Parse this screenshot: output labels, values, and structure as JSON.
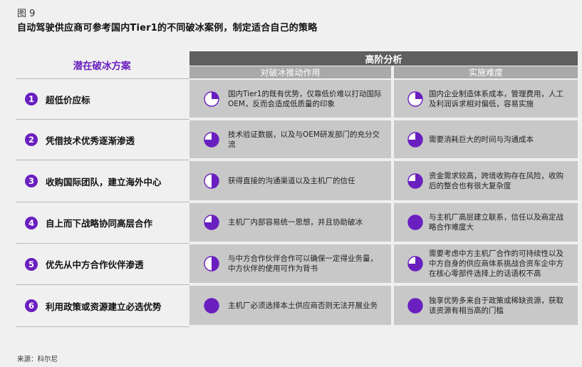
{
  "figure_label": "图 9",
  "title": "自动驾驶供应商可参考国内Tier1的不同破冰案例，制定适合自己的策略",
  "header": {
    "left": "潜在破冰方案",
    "top": "高阶分析",
    "col1": "对破冰推动作用",
    "col2": "实施难度"
  },
  "colors": {
    "accent": "#6a1fbf",
    "header_dark": "#5f5f5f",
    "header_light": "#a9a9a9",
    "cell_bg": "#c8c8c8"
  },
  "rows": [
    {
      "num": "1",
      "label": "超低价应标",
      "col1": {
        "text": "国内Tier1的既有优势，仅靠低价难以打动国际OEM，反而会造成低质量的印象",
        "harvey_quarters": 1
      },
      "col2": {
        "text": "国内企业制造体系成本，管理费用，人工及利润诉求相对偏低，容易实施",
        "harvey_quarters": 1
      }
    },
    {
      "num": "2",
      "label": "凭借技术优秀逐渐渗透",
      "col1": {
        "text": "技术验证数据，以及与OEM研发部门的充分交流",
        "harvey_quarters": 3
      },
      "col2": {
        "text": "需要消耗巨大的时间与沟通成本",
        "harvey_quarters": 3
      }
    },
    {
      "num": "3",
      "label": "收购国际团队，建立海外中心",
      "col1": {
        "text": "获得直接的沟通渠道以及主机厂的信任",
        "harvey_quarters": 2
      },
      "col2": {
        "text": "资金需求较高，跨境收购存在风险，收购后的整合也有很大复杂度",
        "harvey_quarters": 3
      }
    },
    {
      "num": "4",
      "label": "自上而下战略协同高层合作",
      "col1": {
        "text": "主机厂内部容易统一思想，并且协助破冰",
        "harvey_quarters": 3
      },
      "col2": {
        "text": "与主机厂高层建立联系，信任以及商定战略合作难度大",
        "harvey_quarters": 4
      }
    },
    {
      "num": "5",
      "label": "优先从中方合作伙伴渗透",
      "col1": {
        "text": "与中方合作伙伴合作可以确保一定得业务量，中方伙伴的使用可作为背书",
        "harvey_quarters": 2
      },
      "col2": {
        "text": "需要考虑中方主机厂合作的可持续性以及中方自身的供应商体系挑战合资车企中方在核心零部件选择上的话语权不高",
        "harvey_quarters": 3
      }
    },
    {
      "num": "6",
      "label": "利用政策或资源建立必选优势",
      "col1": {
        "text": "主机厂必须选择本土供应商否则无法开展业务",
        "harvey_quarters": 4
      },
      "col2": {
        "text": "独享优势多来自于政策或稀缺资源，获取该资源有相当高的门槛",
        "harvey_quarters": 4
      }
    }
  ],
  "source": "来源：科尔尼"
}
